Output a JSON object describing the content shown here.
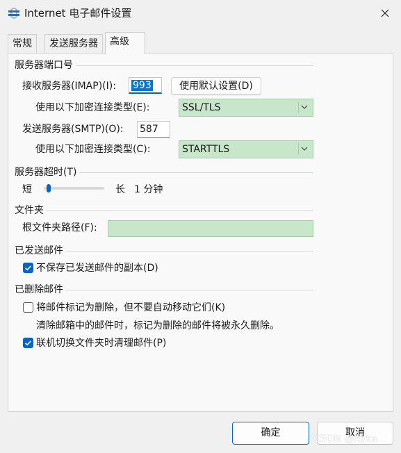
{
  "window": {
    "title": "Internet 电子邮件设置"
  },
  "tabs": [
    {
      "label": "常规"
    },
    {
      "label": "发送服务器"
    },
    {
      "label": "高级"
    }
  ],
  "server_ports": {
    "section_title": "服务器端口号",
    "incoming_label": "接收服务器(IMAP)(I):",
    "incoming_value": "993",
    "default_button": "使用默认设置(D)",
    "incoming_encryption_label": "使用以下加密连接类型(E):",
    "incoming_encryption_value": "SSL/TLS",
    "outgoing_label": "发送服务器(SMTP)(O):",
    "outgoing_value": "587",
    "outgoing_encryption_label": "使用以下加密连接类型(C):",
    "outgoing_encryption_value": "STARTTLS"
  },
  "timeout": {
    "section_title": "服务器超时(T)",
    "short_label": "短",
    "long_label": "长",
    "value_text": "1 分钟",
    "slider_fraction": 0.05
  },
  "folders": {
    "section_title": "文件夹",
    "root_path_label": "根文件夹路径(F):",
    "root_path_value": ""
  },
  "sent_items": {
    "section_title": "已发送邮件",
    "dont_save_label": "不保存已发送邮件的副本(D)",
    "dont_save_checked": true
  },
  "deleted_items": {
    "section_title": "已删除邮件",
    "mark_label": "将邮件标记为删除，但不要自动移动它们(K)",
    "mark_checked": false,
    "mark_note": "清除邮箱中的邮件时，标记为删除的邮件将被永久删除。",
    "purge_label": "联机切换文件夹时清理邮件(P)",
    "purge_checked": true
  },
  "footer": {
    "ok_button": "确定",
    "cancel_button": "取消"
  },
  "watermark": "CSDN @Ayka",
  "icons": {
    "app": "outlook-settings-icon",
    "close": "close-icon",
    "dropdown": "chevron-down-icon",
    "check": "checkmark-icon"
  },
  "colors": {
    "accent": "#0067c0",
    "combo_fill": "#c8e6c9",
    "window_bg": "#f0f0f0"
  }
}
